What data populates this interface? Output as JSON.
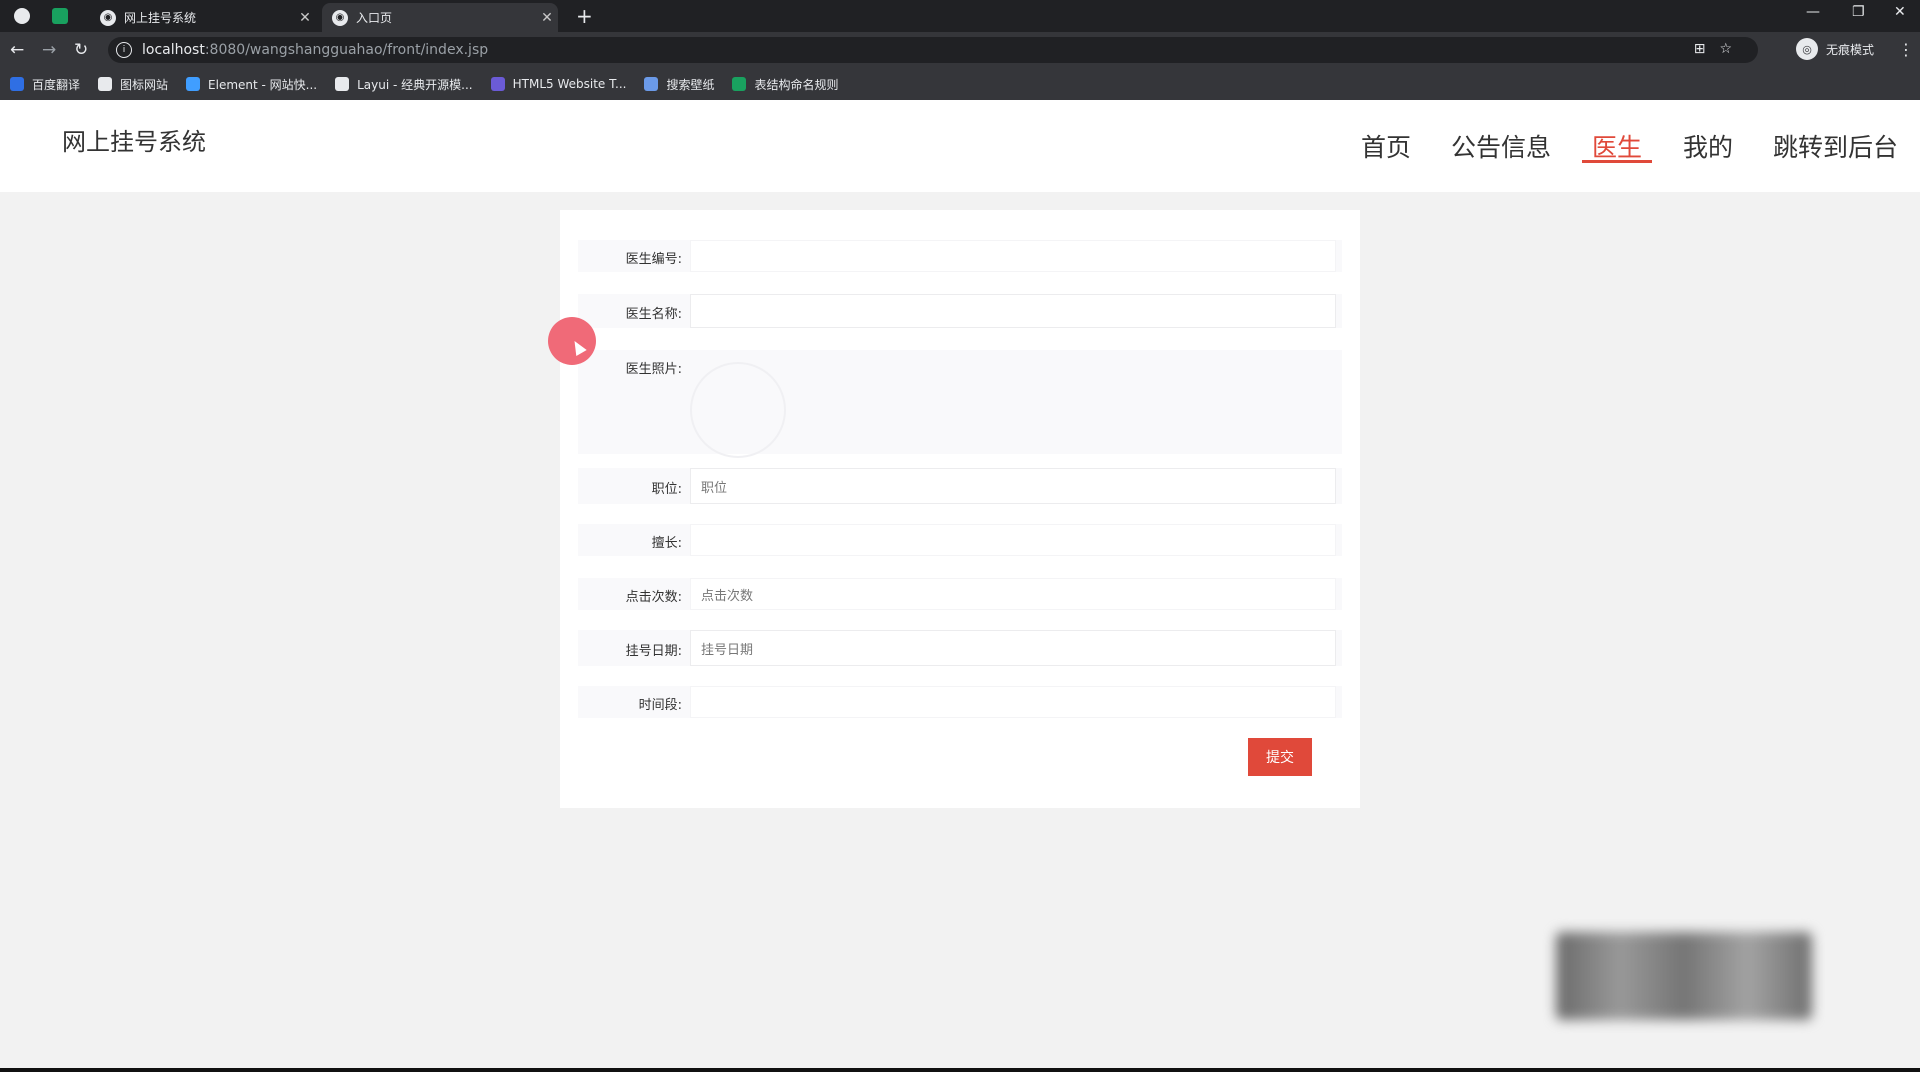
{
  "browser": {
    "tabs": [
      {
        "title": "网上挂号系统"
      },
      {
        "title": "入口页"
      }
    ],
    "url_host": "localhost",
    "url_path": ":8080/wangshangguahao/front/index.jsp",
    "profile_label": "无痕模式",
    "bookmarks": [
      {
        "label": "百度翻译",
        "color": "#2f6fe4"
      },
      {
        "label": "图标网站",
        "color": "#e8eaed"
      },
      {
        "label": "Element - 网站快...",
        "color": "#409eff"
      },
      {
        "label": "Layui - 经典开源模...",
        "color": "#e8eaed"
      },
      {
        "label": "HTML5 Website T...",
        "color": "#6b5bd6"
      },
      {
        "label": "搜索壁纸",
        "color": "#6b9ae8"
      },
      {
        "label": "表结构命名规则",
        "color": "#19a15f"
      }
    ]
  },
  "site": {
    "logo": "网上挂号系统",
    "menu": [
      "首页",
      "公告信息",
      "医生",
      "我的",
      "跳转到后台"
    ],
    "active_menu": "医生",
    "accent_color": "#e0493a"
  },
  "form": {
    "fields": [
      {
        "label": "医生编号:",
        "value": "",
        "placeholder": ""
      },
      {
        "label": "医生名称:",
        "value": "",
        "placeholder": ""
      },
      {
        "label": "医生照片:",
        "type": "upload"
      },
      {
        "label": "职位:",
        "value": "",
        "placeholder": "职位"
      },
      {
        "label": "擅长:",
        "value": "",
        "placeholder": ""
      },
      {
        "label": "点击次数:",
        "value": "",
        "placeholder": "点击次数"
      },
      {
        "label": "挂号日期:",
        "value": "",
        "placeholder": "挂号日期"
      },
      {
        "label": "时间段:",
        "value": "",
        "placeholder": ""
      }
    ],
    "submit_label": "提交"
  }
}
